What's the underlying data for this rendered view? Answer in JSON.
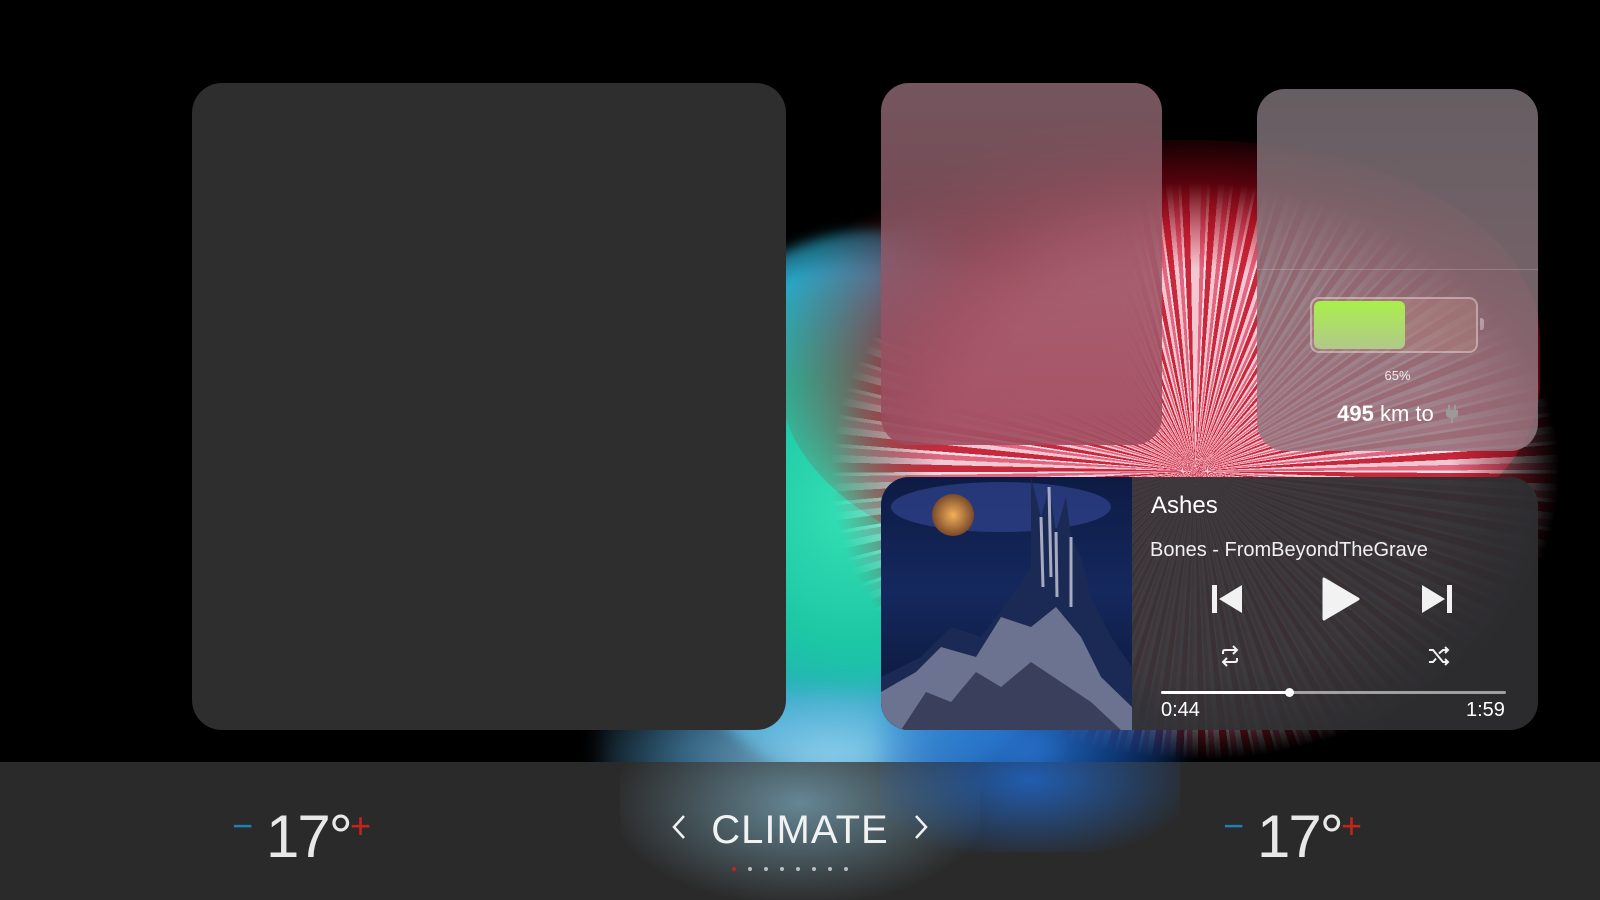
{
  "colors": {
    "accent_red": "#c5231e",
    "accent_blue": "#1f7fb0",
    "battery_green": "#a9ef4a",
    "tile_dark": "#2e2e2e",
    "bar_bg": "#2a2a2a"
  },
  "battery": {
    "level_fraction": 0.57,
    "percent_label": "65%",
    "range_value": "495",
    "range_unit": "km to",
    "charger_icon": "plug-icon"
  },
  "media": {
    "title": "Ashes",
    "artist_album": "Bones - FromBeyondTheGrave",
    "elapsed": "0:44",
    "total": "1:59",
    "progress_fraction": 0.37,
    "icons": {
      "previous": "skip-previous-icon",
      "play": "play-icon",
      "next": "skip-next-icon",
      "repeat": "repeat-icon",
      "shuffle": "shuffle-icon"
    }
  },
  "climate": {
    "label": "CLIMATE",
    "prev_icon": "chevron-left-icon",
    "next_icon": "chevron-right-icon",
    "left": {
      "minus": "−",
      "value": "17°",
      "plus": "+"
    },
    "right": {
      "minus": "−",
      "value": "17°",
      "plus": "+"
    },
    "page_count": 8,
    "active_page": 0
  }
}
